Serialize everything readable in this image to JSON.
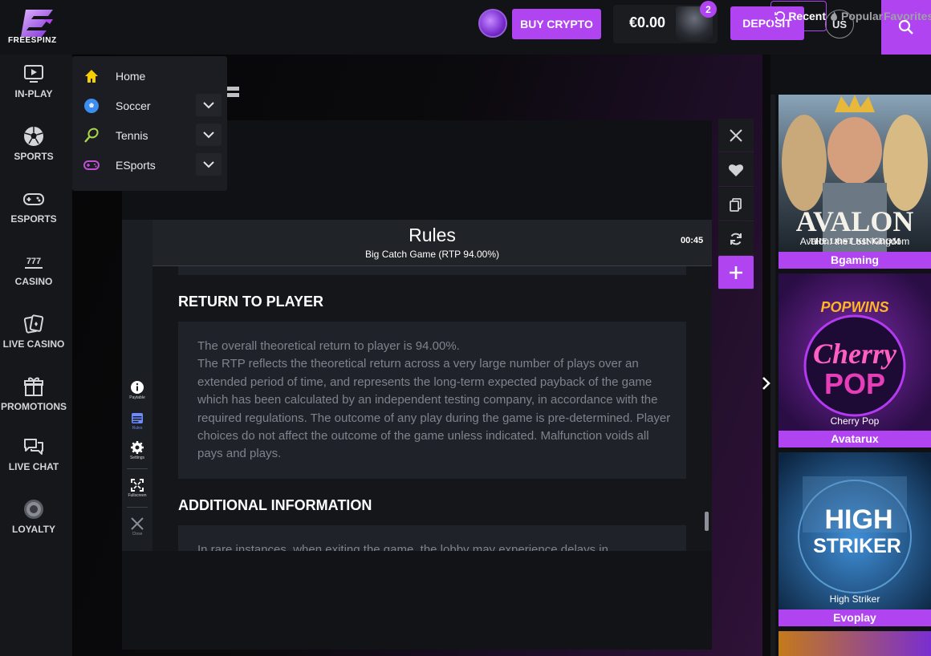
{
  "brand": {
    "name": "FREESPINZ",
    "accent": "#b044f0"
  },
  "header": {
    "buy_crypto": "BUY CRYPTO",
    "balance": "€0.00",
    "notifications": "2",
    "deposit": "DEPOSIT",
    "language": "US"
  },
  "sidebar": {
    "items": [
      {
        "label": "IN-PLAY",
        "icon": "play-icon"
      },
      {
        "label": "SPORTS",
        "icon": "soccer-ball-icon"
      },
      {
        "label": "ESPORTS",
        "icon": "gamepad-icon"
      },
      {
        "label": "CASINO",
        "icon": "slot-777-icon"
      },
      {
        "label": "LIVE CASINO",
        "icon": "cards-icon"
      },
      {
        "label": "PROMOTIONS",
        "icon": "gift-icon"
      },
      {
        "label": "LIVE CHAT",
        "icon": "chat-icon"
      },
      {
        "label": "LOYALTY",
        "icon": "loyalty-icon"
      }
    ]
  },
  "dropdown": {
    "items": [
      {
        "label": "Home",
        "icon": "home-icon"
      },
      {
        "label": "Soccer",
        "icon": "soccer-ball-icon"
      },
      {
        "label": "Tennis",
        "icon": "tennis-icon"
      },
      {
        "label": "ESports",
        "icon": "gamepad-icon"
      }
    ]
  },
  "game": {
    "rules_title": "Rules",
    "rules_subtitle": "Big Catch Game (RTP 94.00%)",
    "timer": "00:45",
    "side_menu": [
      "Paytable",
      "Rules",
      "Settings",
      "Fullscreen",
      "Close"
    ],
    "sections": [
      {
        "heading": "RETURN TO PLAYER",
        "text": "The overall theoretical return to player is 94.00%.\nThe RTP reflects the theoretical return across a very large number of plays over an extended period of time, and represents the long-term expected payback of the game which has been calculated by an independent testing company, in accordance with the required regulations. The outcome of any play during the game is pre-determined. Player choices do not affect the outcome of the game unless indicated. Malfunction voids all pays and plays."
      },
      {
        "heading": "ADDITIONAL INFORMATION",
        "text": "In rare instances, when exiting the game, the lobby may experience delays in"
      }
    ]
  },
  "right_panel": {
    "tabs": [
      "Recent",
      "Popular",
      "Favorites"
    ],
    "cards": [
      {
        "title": "Avalon: the Lost Kingdom",
        "art_text": "AVALON",
        "art_sub": "THE LOST KINGDOM",
        "provider": "Bgaming"
      },
      {
        "title": "Cherry Pop",
        "art_text": "Cherry",
        "art_sub": "POP",
        "art_brand": "POPWINS",
        "provider": "Avatarux"
      },
      {
        "title": "High Striker",
        "art_text": "HIGH",
        "art_sub": "STRIKER",
        "provider": "Evoplay"
      }
    ]
  }
}
